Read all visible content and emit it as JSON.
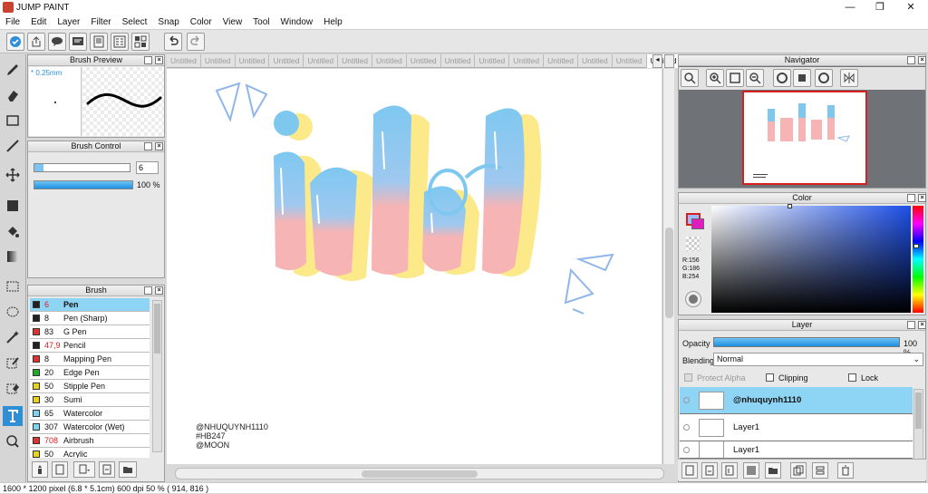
{
  "window": {
    "title": "JUMP PAINT",
    "minimize": "—",
    "maximize": "❐",
    "close": "✕"
  },
  "menu": [
    "File",
    "Edit",
    "Layer",
    "Filter",
    "Select",
    "Snap",
    "Color",
    "View",
    "Tool",
    "Window",
    "Help"
  ],
  "brush_preview": {
    "title": "Brush Preview",
    "size_label": "* 0.25mm"
  },
  "brush_control": {
    "title": "Brush Control",
    "size_value": "6",
    "opacity_value": "100 %"
  },
  "brush": {
    "title": "Brush",
    "items": [
      {
        "size": "6",
        "name": "Pen",
        "color": "#222222",
        "selected": true,
        "size_color": "#d62020"
      },
      {
        "size": "8",
        "name": "Pen (Sharp)",
        "color": "#222222"
      },
      {
        "size": "83",
        "name": "G Pen",
        "color": "#e23030"
      },
      {
        "size": "47,9",
        "name": "Pencil",
        "color": "#222222",
        "size_color": "#d62020"
      },
      {
        "size": "8",
        "name": "Mapping Pen",
        "color": "#e23030"
      },
      {
        "size": "20",
        "name": "Edge Pen",
        "color": "#22aa22"
      },
      {
        "size": "50",
        "name": "Stipple Pen",
        "color": "#e8d21a"
      },
      {
        "size": "30",
        "name": "Sumi",
        "color": "#e8d21a"
      },
      {
        "size": "65",
        "name": "Watercolor",
        "color": "#7ad3f0"
      },
      {
        "size": "307",
        "name": "Watercolor (Wet)",
        "color": "#7ad3f0"
      },
      {
        "size": "708",
        "name": "Airbrush",
        "color": "#e23030",
        "size_color": "#d62020"
      },
      {
        "size": "50",
        "name": "Acrylic",
        "color": "#e8d21a"
      }
    ]
  },
  "tabs": [
    "Untitled",
    "Untitled",
    "Untitled",
    "Untitled",
    "Untitled",
    "Untitled",
    "Untitled",
    "Untitled",
    "Untitled",
    "Untitled",
    "Untitled",
    "Untitled",
    "Untitled",
    "Untitled",
    "Untitled"
  ],
  "active_tab_index": 14,
  "canvas": {
    "word": "idol",
    "credits": [
      "@NHUQUYNH1110",
      "#HB247",
      "@MOON"
    ]
  },
  "navigator": {
    "title": "Navigator"
  },
  "color": {
    "title": "Color",
    "r": "R:156",
    "g": "G:186",
    "b": "B:254"
  },
  "layer": {
    "title": "Layer",
    "opacity_label": "Opacity",
    "opacity_value": "100 %",
    "blending_label": "Blending",
    "blending_value": "Normal",
    "protect_alpha": "Protect Alpha",
    "clipping": "Clipping",
    "lock": "Lock",
    "layers": [
      {
        "name": "@nhuquynh1110",
        "selected": true
      },
      {
        "name": "Layer1"
      },
      {
        "name": "Layer1"
      }
    ]
  },
  "status": "1600 * 1200 pixel   (6.8 * 5.1cm)   600 dpi   50 %   ( 914, 816 )",
  "colors": {
    "accent": "#2f8fd6",
    "selected_row": "#8ed4f5",
    "pink": "#f7b4b4",
    "blue": "#7ec8f0",
    "yellow": "#fbe98a"
  }
}
